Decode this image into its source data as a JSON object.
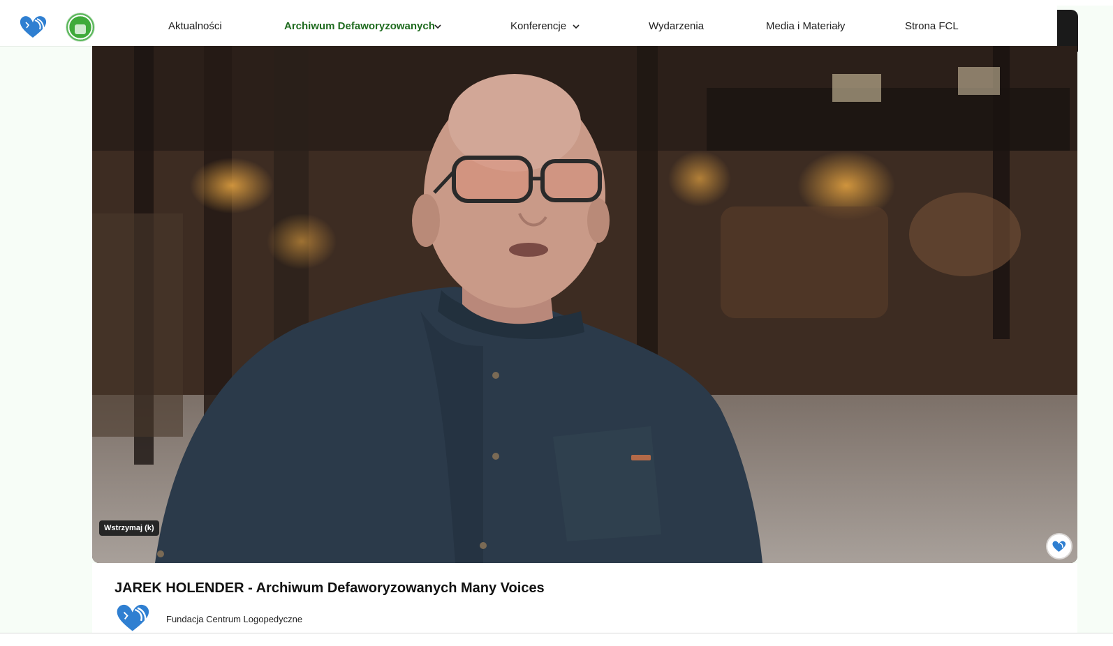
{
  "header": {
    "logo_icon": "heart-face-logo-icon",
    "badge_icon": "green-round-badge-icon",
    "nav": [
      {
        "label": "Aktualności",
        "active": false,
        "dropdown": false
      },
      {
        "label": "Archiwum Defaworyzowanych",
        "active": true,
        "dropdown": true
      },
      {
        "label": "Konferencje",
        "active": false,
        "dropdown": true
      },
      {
        "label": "Wydarzenia",
        "active": false,
        "dropdown": false
      },
      {
        "label": "Media i Materiały",
        "active": false,
        "dropdown": false
      },
      {
        "label": "Strona FCL",
        "active": false,
        "dropdown": false
      }
    ],
    "dropdown_icon": "chevron-down-icon"
  },
  "video": {
    "pause_tooltip": "Wstrzymaj (k)",
    "channel_watermark_icon": "heart-face-logo-icon"
  },
  "info": {
    "title": "JAREK HOLENDER - Archiwum Defaworyzowanych Many Voices",
    "channel_name": "Fundacja Centrum Logopedyczne"
  },
  "colors": {
    "page_background": "#f7fdf7",
    "active_nav": "#1f6b1f",
    "logo_blue": "#2f7fd1"
  }
}
